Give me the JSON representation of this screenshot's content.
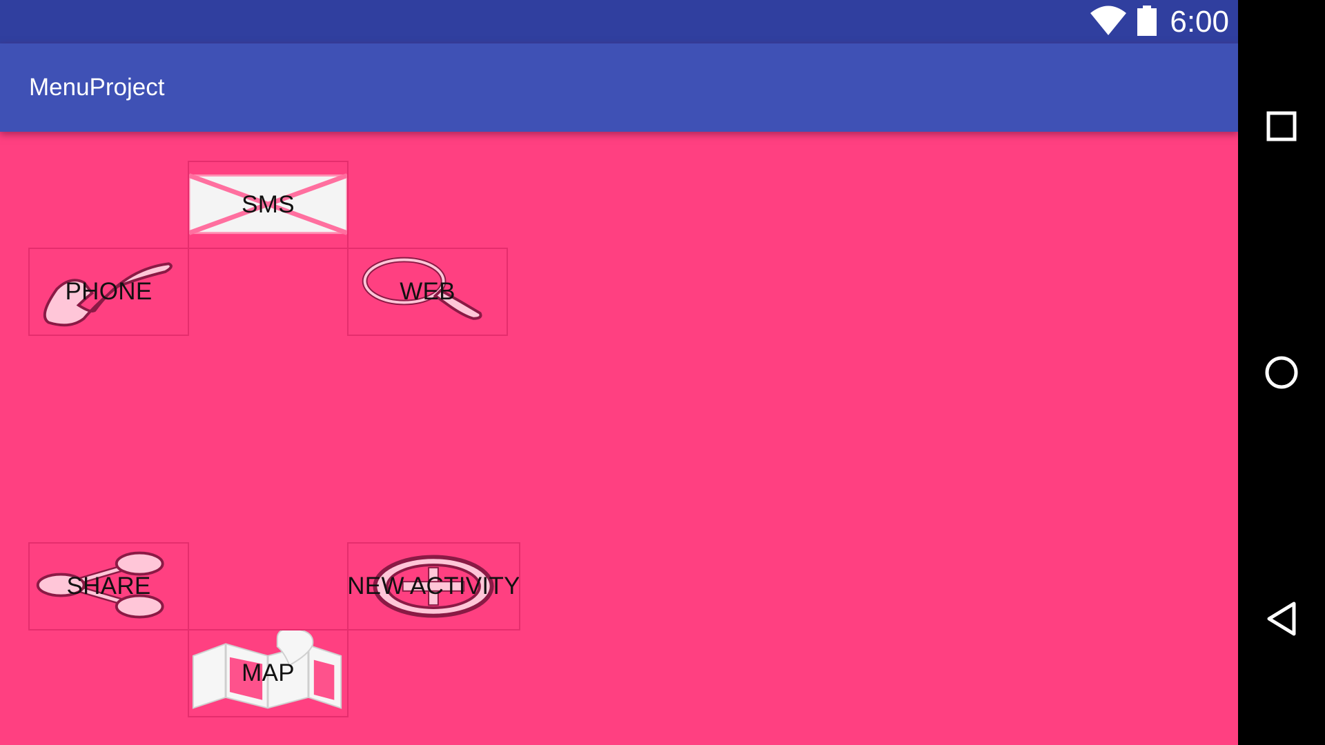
{
  "status_bar": {
    "time": "6:00",
    "icons": [
      "wifi-icon",
      "battery-icon"
    ],
    "color": "#303f9f"
  },
  "app_bar": {
    "title": "MenuProject",
    "color": "#3f51b5"
  },
  "content": {
    "background": "#ff4081",
    "buttons": {
      "sms": {
        "label": "SMS",
        "icon": "envelope-icon"
      },
      "phone": {
        "label": "PHONE",
        "icon": "phone-handset-icon"
      },
      "web": {
        "label": "WEB",
        "icon": "magnifier-icon"
      },
      "share": {
        "label": "SHARE",
        "icon": "share-icon"
      },
      "new_activity": {
        "label": "NEW ACTIVITY",
        "icon": "plus-circle-icon"
      },
      "map": {
        "label": "MAP",
        "icon": "map-icon"
      }
    }
  },
  "nav_bar": {
    "buttons": [
      "recents-icon",
      "home-icon",
      "back-icon"
    ]
  }
}
